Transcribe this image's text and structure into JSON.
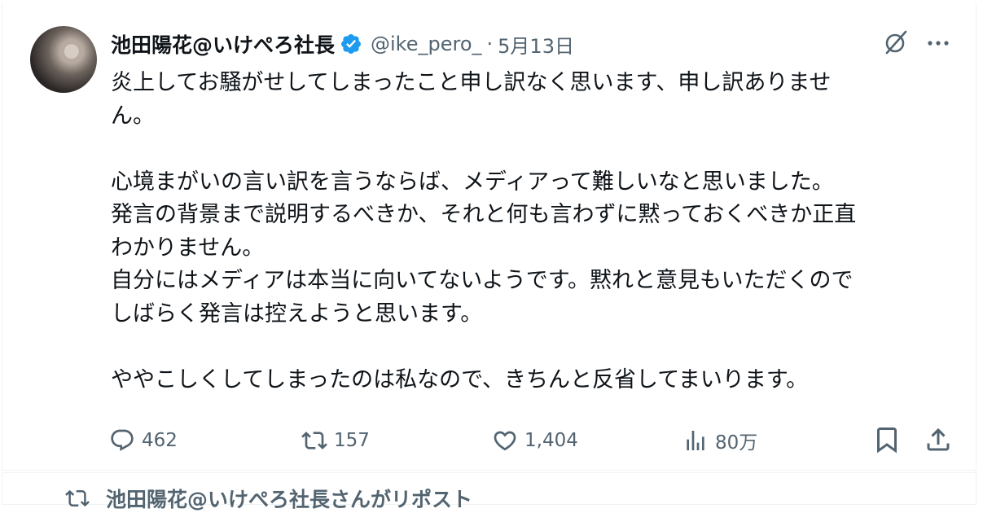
{
  "tweet": {
    "display_name": "池田陽花@いけぺろ社長",
    "handle": "@ike_pero_",
    "separator": "·",
    "date": "5月13日",
    "lines": [
      "炎上してお騒がせしてしまったこと申し訳なく思います、申し訳ありませ",
      "ん。",
      "",
      "心境まがいの言い訳を言うならば、メディアって難しいなと思いました。",
      "発言の背景まで説明するべきか、それと何も言わずに黙っておくべきか正直",
      "わかりません。",
      "自分にはメディアは本当に向いてないようです。黙れと意見もいただくので",
      "しばらく発言は控えようと思います。",
      "",
      "ややこしくしてしまったのは私なので、きちんと反省してまいります。"
    ],
    "stats": {
      "replies": "462",
      "reposts": "157",
      "likes": "1,404",
      "views": "80万"
    }
  },
  "next_item": {
    "repost_label": "池田陽花@いけぺろ社長さんがリポスト"
  },
  "colors": {
    "text": "#0f1419",
    "secondary": "#536471",
    "verified": "#1d9bf0"
  },
  "icons": [
    "verified-badge-icon",
    "grok-icon",
    "more-icon",
    "reply-icon",
    "repost-icon",
    "like-icon",
    "views-icon",
    "bookmark-icon",
    "share-icon"
  ]
}
